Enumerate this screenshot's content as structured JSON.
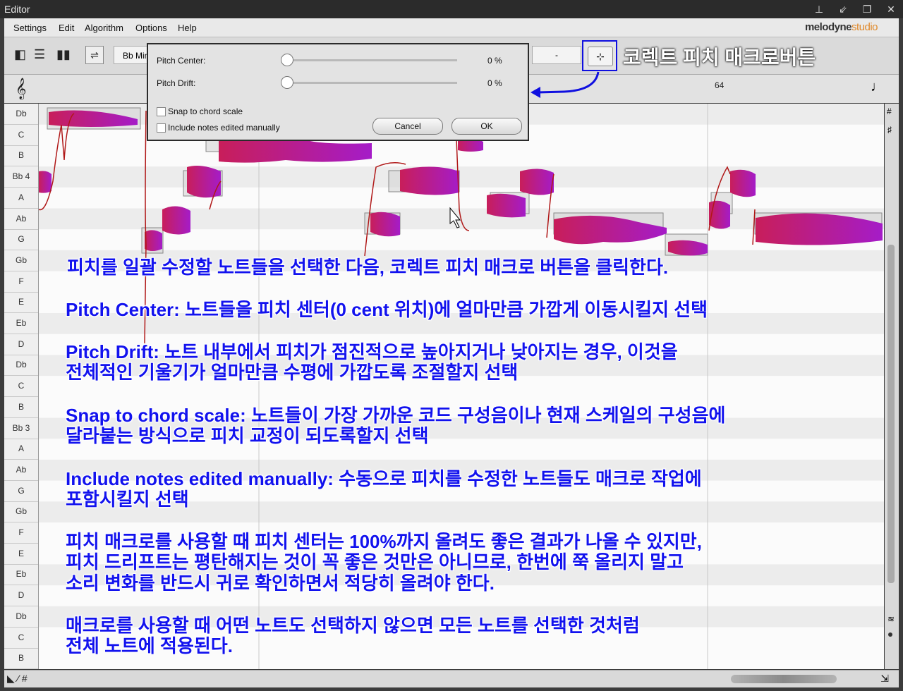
{
  "window": {
    "title": "Editor"
  },
  "menu": [
    "Settings",
    "Edit",
    "Algorithm",
    "Options",
    "Help"
  ],
  "brand": {
    "name": "melodyne",
    "edition": "studio"
  },
  "toolbar": {
    "scale_label": "Bb Min",
    "field_value": "-"
  },
  "ruler": {
    "bar_label": "64"
  },
  "keys": [
    "Db",
    "C",
    "B",
    "Bb 4",
    "A",
    "Ab",
    "G",
    "Gb",
    "F",
    "E",
    "Eb",
    "D",
    "Db",
    "C",
    "B",
    "Bb 3",
    "A",
    "Ab",
    "G",
    "Gb",
    "F",
    "E",
    "Eb",
    "D",
    "Db",
    "C",
    "B"
  ],
  "dialog": {
    "pitch_center_label": "Pitch Center:",
    "pitch_center_value": "0 %",
    "pitch_center_level": 0,
    "pitch_drift_label": "Pitch Drift:",
    "pitch_drift_value": "0 %",
    "pitch_drift_level": 0,
    "snap_label": "Snap to chord scale",
    "snap_checked": false,
    "include_label": "Include notes edited manually",
    "include_checked": false,
    "cancel_label": "Cancel",
    "ok_label": "OK"
  },
  "callout": "코렉트 피치 매크로버튼",
  "annotations": [
    "피치를 일괄 수정할 노트들을 선택한 다음, 코렉트 피치 매크로 버튼을 클릭한다.",
    "Pitch Center: 노트들을 피치 센터(0 cent 위치)에 얼마만큼 가깝게 이동시킬지 선택",
    "Pitch Drift:  노트 내부에서 피치가 점진적으로 높아지거나 낮아지는 경우, 이것을",
    "전체적인 기울기가 얼마만큼 수평에 가깝도록 조절할지 선택",
    "Snap to chord scale: 노트들이 가장 가까운 코드 구성음이나 현재 스케일의 구성음에",
    "달라붙는 방식으로 피치 교정이 되도록할지 선택",
    "Include notes edited manually: 수동으로 피치를 수정한 노트들도 매크로 작업에",
    "포함시킬지 선택",
    "피치 매크로를 사용할 때 피치 센터는 100%까지 올려도 좋은 결과가 나올 수 있지만,",
    "피치 드리프트는 평탄해지는 것이 꼭 좋은 것만은 아니므로, 한번에 쭉 올리지 말고",
    "소리 변화를 반드시 귀로 확인하면서 적당히 올려야 한다.",
    "매크로를 사용할 때 어떤 노트도 선택하지 않으면 모든 노트를 선택한 것처럼",
    "전체 노트에 적용된다."
  ],
  "colors": {
    "annotation_text": "#1212ee",
    "highlight_border": "#1010e0",
    "blob_start": "#c81e5a",
    "blob_end": "#a51cc8"
  }
}
